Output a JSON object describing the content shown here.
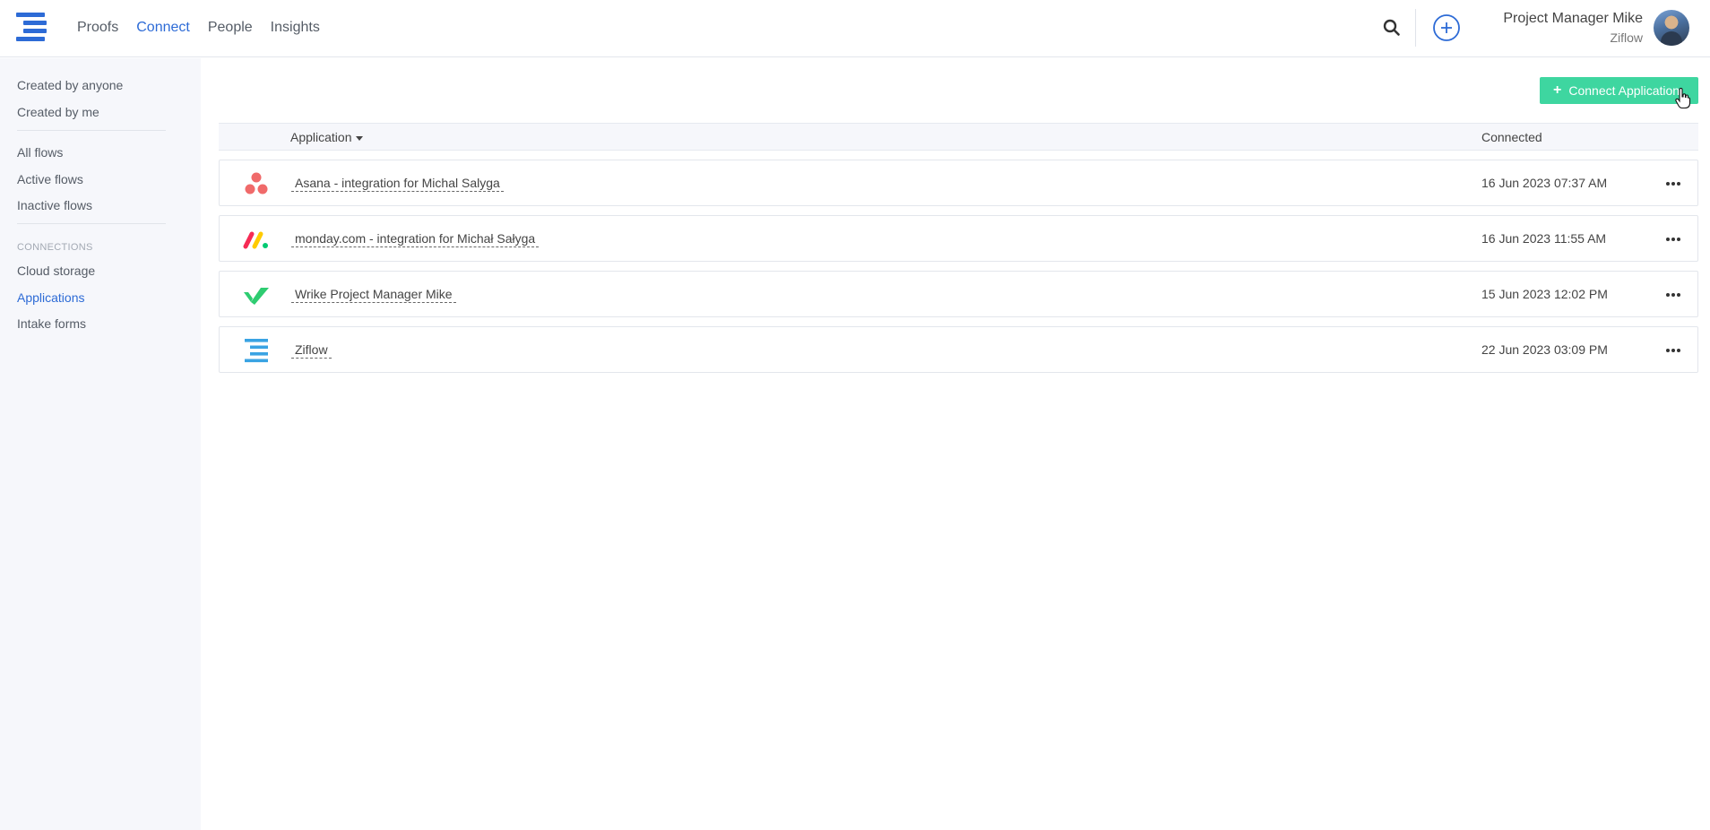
{
  "header": {
    "nav": [
      {
        "label": "Proofs",
        "active": false
      },
      {
        "label": "Connect",
        "active": true
      },
      {
        "label": "People",
        "active": false
      },
      {
        "label": "Insights",
        "active": false
      }
    ],
    "user": {
      "name": "Project Manager Mike",
      "org": "Ziflow"
    },
    "icons": [
      "ziflow-logo-icon",
      "search-icon",
      "add-circle-icon",
      "avatar"
    ]
  },
  "sidebar": {
    "filters": [
      "Created by anyone",
      "Created by me"
    ],
    "flows": [
      "All flows",
      "Active flows",
      "Inactive flows"
    ],
    "connections_heading": "CONNECTIONS",
    "connections": [
      {
        "label": "Cloud storage",
        "active": false
      },
      {
        "label": "Applications",
        "active": true
      },
      {
        "label": "Intake forms",
        "active": false
      }
    ]
  },
  "main": {
    "connect_button_label": "Connect Application",
    "table": {
      "columns": {
        "application": "Application",
        "connected": "Connected"
      },
      "rows": [
        {
          "icon": "asana-icon",
          "name": "Asana - integration for Michal Salyga",
          "connected": "16 Jun 2023 07:37 AM"
        },
        {
          "icon": "monday-icon",
          "name": "monday.com - integration for Michał Sałyga",
          "connected": "16 Jun 2023 11:55 AM"
        },
        {
          "icon": "wrike-icon",
          "name": "Wrike Project Manager Mike",
          "connected": "15 Jun 2023 12:02 PM"
        },
        {
          "icon": "ziflow-icon",
          "name": "Ziflow",
          "connected": "22 Jun 2023 03:09 PM"
        }
      ]
    }
  },
  "colors": {
    "accent": "#2d6bd6",
    "button_green": "#3ed6a0",
    "sidebar_bg": "#f6f7fb",
    "asana": "#f06a6a",
    "wrike": "#2ecc71",
    "ziflow_icon": "#3aa3e3"
  }
}
